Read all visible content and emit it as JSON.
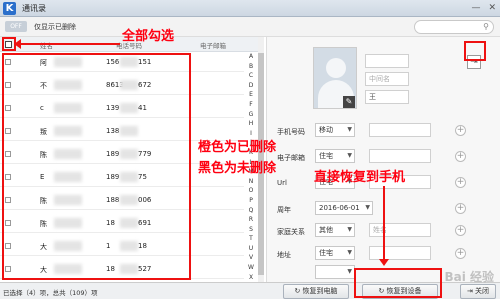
{
  "window": {
    "title": "通讯录",
    "app_icon": "K",
    "minimize": "—",
    "close": "✕"
  },
  "toolbar": {
    "toggle_text": "OFF",
    "toggle_label": "仅显示已删除",
    "search_icon": "search-icon"
  },
  "list": {
    "columns": [
      "姓名",
      "电话号码",
      "电子邮箱"
    ],
    "rows": [
      {
        "name": "阿",
        "phone": "156",
        "phone_end": "151"
      },
      {
        "name": "不",
        "phone": "8613",
        "phone_end": "672"
      },
      {
        "name": "c",
        "phone": "139",
        "phone_end": "41"
      },
      {
        "name": "叛",
        "phone": "138",
        "phone_end": ""
      },
      {
        "name": "陈",
        "phone": "189",
        "phone_end": "779"
      },
      {
        "name": "E",
        "phone": "189",
        "phone_end": "75"
      },
      {
        "name": "陈",
        "phone": "188",
        "phone_end": "006"
      },
      {
        "name": "陈",
        "phone": "18",
        "phone_end": "691"
      },
      {
        "name": "大",
        "phone": "1",
        "phone_end": "18"
      },
      {
        "name": "大",
        "phone": "18",
        "phone_end": "527"
      }
    ],
    "alphabet": [
      "A",
      "B",
      "C",
      "D",
      "E",
      "F",
      "G",
      "H",
      "I",
      "J",
      "K",
      "L",
      "M",
      "N",
      "O",
      "P",
      "Q",
      "R",
      "S",
      "T",
      "U",
      "V",
      "W",
      "X",
      "Y",
      "Z",
      "#"
    ]
  },
  "detail": {
    "middle_name_placeholder": "中间名",
    "last_name": "王",
    "fields": [
      {
        "label": "手机号码",
        "type": "移动"
      },
      {
        "label": "电子邮箱",
        "type": "住宅"
      },
      {
        "label": "Url",
        "type": "住宅"
      },
      {
        "label": "周年",
        "value": "2016-06-01"
      },
      {
        "label": "家庭关系",
        "type": "其他",
        "placeholder": "姓名"
      },
      {
        "label": "地址",
        "type": "住宅"
      }
    ]
  },
  "footer": {
    "status": "已选择（4）项，总共（109）项",
    "restore_pc": "恢复到电脑",
    "restore_device": "恢复到设备",
    "close": "关闭"
  },
  "annotations": {
    "select_all": "全部勾选",
    "orange_deleted": "橙色为已删除",
    "black_not_deleted": "黑色为未删除",
    "restore_phone": "直接恢复到手机"
  },
  "watermark": "Bai 经验",
  "colors": {
    "annotation": "#ee1111",
    "accent": "#2b6fcb"
  }
}
